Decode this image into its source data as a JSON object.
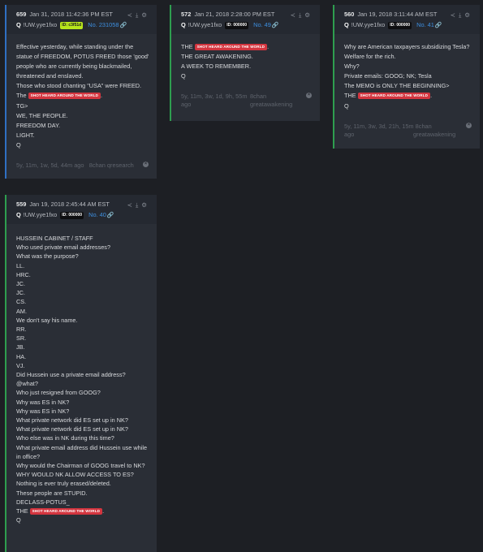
{
  "posts": [
    {
      "num": "659",
      "date": "Jan 31, 2018 11:42:36 PM EST",
      "author": "Q",
      "trip": "!UW.yye1fxo",
      "id_badge": "ID: c3f51d",
      "post_no": "No. 231058",
      "lines": [
        [
          "Effective yesterday, while standing under the"
        ],
        [
          "statue of FREEDOM, POTUS FREED those 'good'"
        ],
        [
          "people who are currently being blackmailed,"
        ],
        [
          "threatened and enslaved."
        ],
        [
          "Those who stood chanting \"USA\" were FREED."
        ],
        [
          "The ",
          "SHOT HEARD AROUND THE WORLD",
          "."
        ],
        [
          "TG>"
        ],
        [
          "WE, THE PEOPLE."
        ],
        [
          "FREEDOM DAY."
        ],
        [
          "LIGHT."
        ],
        [
          "Q"
        ]
      ],
      "age": "5y, 11m, 1w, 5d, 44m ago",
      "board": "8chan qresearch"
    },
    {
      "num": "572",
      "date": "Jan 21, 2018 2:28:00 PM EST",
      "author": "Q",
      "trip": "!UW.yye1fxo",
      "id_badge": "ID: 000000",
      "post_no": "No. 49",
      "lines": [
        [
          "THE ",
          "SHOT HEARD AROUND THE WORLD",
          "."
        ],
        [
          "THE GREAT AWAKENING."
        ],
        [
          "A WEEK TO REMEMBER."
        ],
        [
          "Q"
        ]
      ],
      "age": "5y, 11m, 3w, 1d, 9h, 55m",
      "age2": "ago",
      "board": "8chan",
      "board2": "greatawakening"
    },
    {
      "num": "560",
      "date": "Jan 19, 2018 3:11:44 AM EST",
      "author": "Q",
      "trip": "!UW.yye1fxo",
      "id_badge": "ID: 000000",
      "post_no": "No. 41",
      "lines": [
        [
          "Why are American taxpayers subsidizing Tesla?"
        ],
        [
          "Welfare for the rich."
        ],
        [
          "Why?"
        ],
        [
          "Private emails: GOOG; NK; Tesla"
        ],
        [
          "The MEMO is ONLY THE BEGINNING>"
        ],
        [
          "THE ",
          "SHOT HEARD AROUND THE WORLD",
          "."
        ],
        [
          "Q"
        ]
      ],
      "age": "5y, 11m, 3w, 3d, 21h, 15m 8chan",
      "age2": "ago",
      "board2": "greatawakening"
    },
    {
      "num": "559",
      "date": "Jan 19, 2018 2:45:44 AM EST",
      "author": "Q",
      "trip": "!UW.yye1fxo",
      "id_badge": "ID: 000000",
      "post_no": "No. 40",
      "lines": [
        [
          "HUSSEIN CABINET / STAFF"
        ],
        [
          "Who used private email addresses?"
        ],
        [
          "What was the purpose?"
        ],
        [
          "LL."
        ],
        [
          "HRC."
        ],
        [
          "JC."
        ],
        [
          "JC."
        ],
        [
          "CS."
        ],
        [
          "AM."
        ],
        [
          "We don't say his name."
        ],
        [
          "RR."
        ],
        [
          "SR."
        ],
        [
          "JB."
        ],
        [
          "HA."
        ],
        [
          "VJ."
        ],
        [
          "Did Hussein use a private email address?"
        ],
        [
          "@what?"
        ],
        [
          "Who just resigned from GOOG?"
        ],
        [
          "Why was ES in NK?"
        ],
        [
          "Why was ES in NK?"
        ],
        [
          "What private network did ES set up in NK?"
        ],
        [
          "What private network did ES set up in NK?"
        ],
        [
          "Who else was in NK during this time?"
        ],
        [
          "What private email address did Hussein use while"
        ],
        [
          "in office?"
        ],
        [
          "Why would the Chairman of GOOG travel to NK?"
        ],
        [
          "WHY WOULD NK ALLOW ACCESS TO ES?"
        ],
        [
          "Nothing is ever truly erased/deleted."
        ],
        [
          "These people are STUPID."
        ],
        [
          "DECLASS-POTUS_"
        ],
        [
          "THE ",
          "SHOT HEARD AROUND THE WORLD",
          "."
        ],
        [
          "Q"
        ]
      ]
    }
  ]
}
